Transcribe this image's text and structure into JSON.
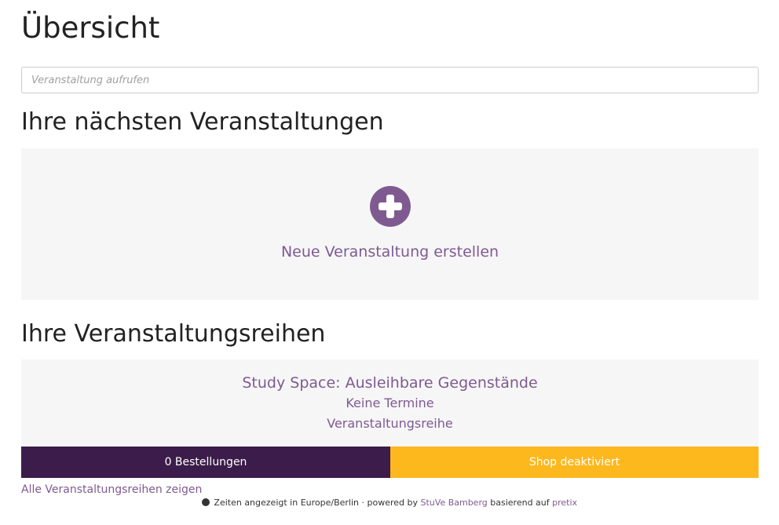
{
  "page": {
    "title": "Übersicht"
  },
  "search": {
    "placeholder": "Veranstaltung aufrufen"
  },
  "events": {
    "heading": "Ihre nächsten Veranstaltungen",
    "create_label": "Neue Veranstaltung erstellen",
    "create_icon": "plus-circle-icon"
  },
  "series": {
    "heading": "Ihre Veranstaltungsreihen",
    "items": [
      {
        "name": "Study Space: Ausleihbare Gegenstände",
        "dates": "Keine Termine",
        "type": "Veranstaltungsreihe",
        "orders": "0 Bestellungen",
        "shop_status": "Shop deaktiviert"
      }
    ],
    "all_link": "Alle Veranstaltungsreihen zeigen"
  },
  "footer": {
    "icon": "globe-icon",
    "prefix": "Zeiten angezeigt in Europe/Berlin · powered by",
    "org_link": "StuVe Bamberg",
    "middle": "basierend auf",
    "pretix_link": "pretix"
  },
  "colors": {
    "accent": "#7f5a91",
    "dark_purple": "#3b1c4a",
    "warning": "#fdb81e",
    "panel_bg": "#f6f6f6"
  }
}
